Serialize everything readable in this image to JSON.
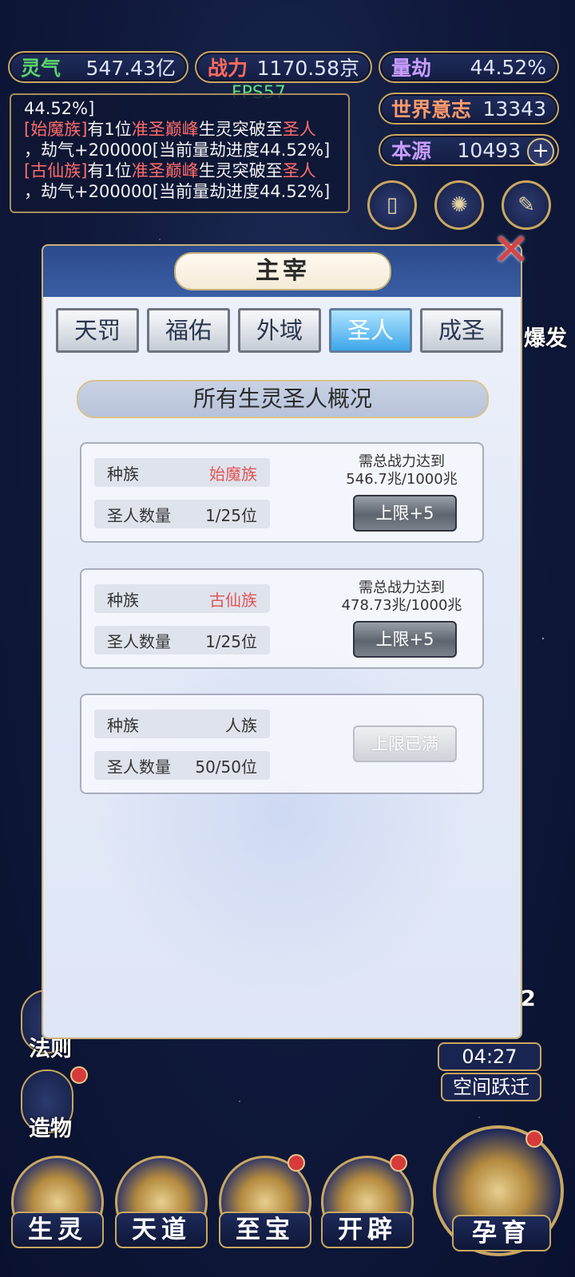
{
  "resources": {
    "lingqi": {
      "label": "灵气",
      "value": "547.43亿"
    },
    "zhanli": {
      "label": "战力",
      "value": "1170.58京"
    },
    "liangjie": {
      "label": "量劫",
      "value": "44.52%"
    },
    "shijie": {
      "label": "世界意志",
      "value": "13343"
    },
    "benyuan": {
      "label": "本源",
      "value": "10493"
    }
  },
  "fps": "FPS57",
  "log": {
    "line0": "44.52%]",
    "entries": [
      {
        "race": "[始魔族]",
        "a": "有1位",
        "lvl": "准圣巅峰",
        "b": "生灵突破至",
        "c": "圣人",
        "d": "，劫气+200000[当前量劫进度44.52%]"
      },
      {
        "race": "[古仙族]",
        "a": "有1位",
        "lvl": "准圣巅峰",
        "b": "生灵突破至",
        "c": "圣人",
        "d": "，劫气+200000[当前量劫进度44.52%]"
      }
    ]
  },
  "side": {
    "right_partial": "爆发",
    "fa_ze": "法则",
    "zao_wu": "造物",
    "right_2": "2",
    "timer": "04:27",
    "kongjian": "空间跃迁"
  },
  "dialog": {
    "title": "主宰",
    "tabs": [
      "天罚",
      "福佑",
      "外域",
      "圣人",
      "成圣"
    ],
    "active_tab": "圣人",
    "section_title": "所有生灵圣人概况",
    "cards": [
      {
        "race_label": "种族",
        "race": "始魔族",
        "count_label": "圣人数量",
        "count": "1/25位",
        "req_label": "需总战力达到",
        "req": "546.7兆/1000兆",
        "button": "上限+5"
      },
      {
        "race_label": "种族",
        "race": "古仙族",
        "count_label": "圣人数量",
        "count": "1/25位",
        "req_label": "需总战力达到",
        "req": "478.73兆/1000兆",
        "button": "上限+5"
      },
      {
        "race_label": "种族",
        "race": "人族",
        "count_label": "圣人数量",
        "count": "50/50位",
        "button": "上限已满"
      }
    ]
  },
  "bottom_nav": [
    "生灵",
    "天道",
    "至宝",
    "开辟",
    "孕育"
  ]
}
